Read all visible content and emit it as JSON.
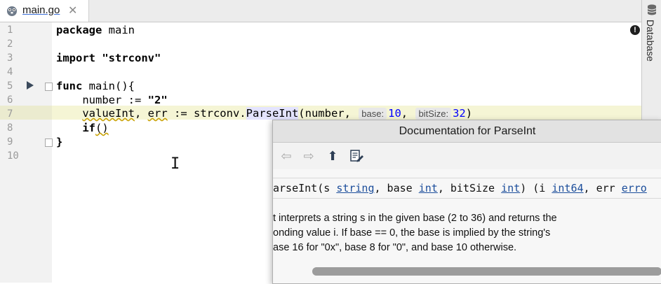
{
  "tab": {
    "filename": "main.go",
    "close_glyph": "✕"
  },
  "right_panel": {
    "label": "Database",
    "icon": "database-icon"
  },
  "editor": {
    "line_numbers": [
      "1",
      "2",
      "3",
      "4",
      "5",
      "6",
      "7",
      "8",
      "9",
      "10"
    ],
    "lines": {
      "l1_kw": "package",
      "l1_rest": " main",
      "l3_kw": "import",
      "l3_str": " \"strconv\"",
      "l5_kw": "func",
      "l5_rest": " main(){",
      "l6_a": "    number := ",
      "l6_str": "\"2\"",
      "l7_a": "    ",
      "l7_var": "valueInt",
      "l7_b": ", ",
      "l7_err": "err",
      "l7_c": " := strconv.",
      "l7_fn": "ParseInt",
      "l7_d": "(number, ",
      "l7_hint1": "base:",
      "l7_num1": "10",
      "l7_e": ", ",
      "l7_hint2": "bitSize:",
      "l7_num2": "32",
      "l7_f": ")",
      "l8_a": "    ",
      "l8_kw": "if",
      "l8_paren": "()",
      "l9": "}"
    }
  },
  "doc_popup": {
    "title": "Documentation for ParseInt",
    "toolbar": {
      "back": "⇦",
      "forward": "⇨",
      "up": "⬆",
      "edit": "edit-source-icon"
    },
    "signature": {
      "a": "arseInt(s ",
      "t1": "string",
      "b": ", base ",
      "t2": "int",
      "c": ", bitSize ",
      "t3": "int",
      "d": ") (i ",
      "t4": "int64",
      "e": ", err ",
      "t5": "erro"
    },
    "description": [
      "t interprets a string s in the given base (2 to 36) and returns the",
      "onding value i. If base == 0, the base is implied by the string's",
      "ase 16 for \"0x\", base 8 for \"0\", and base 10 otherwise."
    ]
  },
  "colors": {
    "keyword": "#000080",
    "string": "#0a7a0a",
    "link": "#1b4d9b",
    "number": "#0000ff"
  }
}
